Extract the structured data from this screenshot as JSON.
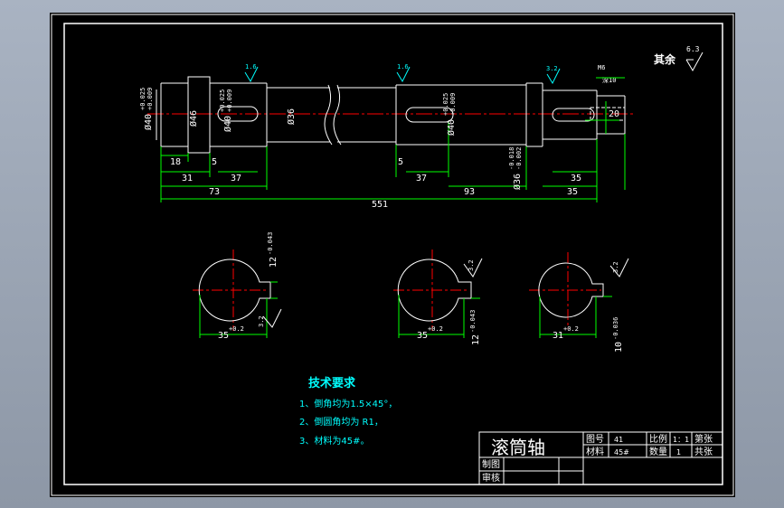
{
  "colors": {
    "background": "#000000",
    "outline": "#ffffff",
    "dimension": "#00ff00",
    "center_line": "#ff0000",
    "annotation": "#00ffff",
    "hatch_line": "#ffffff"
  },
  "drawing_title": "滚筒轴",
  "other_roughness": {
    "label": "其余",
    "value": "6.3"
  },
  "front_view": {
    "roughness": [
      "1.6",
      "1.6",
      "3.2"
    ],
    "diameters": {
      "d40_left": {
        "base": "Ø40",
        "upper": "+0.025",
        "lower": "+0.009"
      },
      "d46": "Ø46",
      "d40_key": {
        "base": "Ø40",
        "upper": "+0.025",
        "lower": "+0.009"
      },
      "d36": "Ø36",
      "d40_right": {
        "base": "Ø40",
        "upper": "+0.025",
        "lower": "+0.009"
      },
      "d36_end": {
        "base": "Ø36",
        "upper": "-0.018",
        "lower": "-0.002"
      }
    },
    "lengths": {
      "l18": "18",
      "l5a": "5",
      "l31": "31",
      "l37a": "37",
      "l73": "73",
      "l5b": "5",
      "l37b": "37",
      "l93": "93",
      "l551": "551",
      "l35a": "35",
      "l35b": "35",
      "l20": "20"
    },
    "end_feature": {
      "thread": "M6",
      "depth": "深10"
    }
  },
  "sections": [
    {
      "width": "35",
      "tol": "+0.2",
      "key": "12",
      "key_lower": "-0.043",
      "roughness": "3.2"
    },
    {
      "width": "35",
      "tol": "+0.2",
      "key": "12",
      "key_lower": "-0.043",
      "roughness": "3.2"
    },
    {
      "width": "31",
      "tol": "+0.2",
      "key": "10",
      "key_lower": "-0.036",
      "roughness": "3.2"
    }
  ],
  "requirements": {
    "title": "技术要求",
    "items": [
      "1、倒角均为1.5×45°，",
      "2、倒圆角均为 R1，",
      "3、材料为45#。"
    ]
  },
  "title_block": {
    "drawing_no_label": "图号",
    "drawing_no_value": "41",
    "scale_label": "比例",
    "scale_value": "1：1",
    "sheet_label": "第张",
    "material_label": "材料",
    "material_value": "45#",
    "qty_label": "数量",
    "qty_value": "1",
    "total_label": "共张",
    "drawn_label": "制图",
    "checked_label": "审核"
  }
}
